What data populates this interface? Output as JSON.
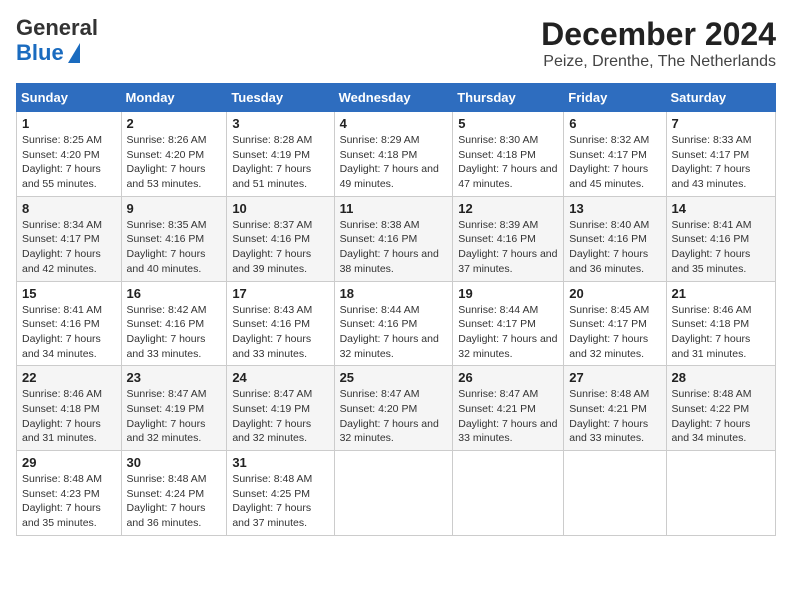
{
  "logo": {
    "line1": "General",
    "line2": "Blue"
  },
  "title": "December 2024",
  "subtitle": "Peize, Drenthe, The Netherlands",
  "days_of_week": [
    "Sunday",
    "Monday",
    "Tuesday",
    "Wednesday",
    "Thursday",
    "Friday",
    "Saturday"
  ],
  "weeks": [
    [
      {
        "day": "1",
        "sunrise": "8:25 AM",
        "sunset": "4:20 PM",
        "daylight": "7 hours and 55 minutes."
      },
      {
        "day": "2",
        "sunrise": "8:26 AM",
        "sunset": "4:20 PM",
        "daylight": "7 hours and 53 minutes."
      },
      {
        "day": "3",
        "sunrise": "8:28 AM",
        "sunset": "4:19 PM",
        "daylight": "7 hours and 51 minutes."
      },
      {
        "day": "4",
        "sunrise": "8:29 AM",
        "sunset": "4:18 PM",
        "daylight": "7 hours and 49 minutes."
      },
      {
        "day": "5",
        "sunrise": "8:30 AM",
        "sunset": "4:18 PM",
        "daylight": "7 hours and 47 minutes."
      },
      {
        "day": "6",
        "sunrise": "8:32 AM",
        "sunset": "4:17 PM",
        "daylight": "7 hours and 45 minutes."
      },
      {
        "day": "7",
        "sunrise": "8:33 AM",
        "sunset": "4:17 PM",
        "daylight": "7 hours and 43 minutes."
      }
    ],
    [
      {
        "day": "8",
        "sunrise": "8:34 AM",
        "sunset": "4:17 PM",
        "daylight": "7 hours and 42 minutes."
      },
      {
        "day": "9",
        "sunrise": "8:35 AM",
        "sunset": "4:16 PM",
        "daylight": "7 hours and 40 minutes."
      },
      {
        "day": "10",
        "sunrise": "8:37 AM",
        "sunset": "4:16 PM",
        "daylight": "7 hours and 39 minutes."
      },
      {
        "day": "11",
        "sunrise": "8:38 AM",
        "sunset": "4:16 PM",
        "daylight": "7 hours and 38 minutes."
      },
      {
        "day": "12",
        "sunrise": "8:39 AM",
        "sunset": "4:16 PM",
        "daylight": "7 hours and 37 minutes."
      },
      {
        "day": "13",
        "sunrise": "8:40 AM",
        "sunset": "4:16 PM",
        "daylight": "7 hours and 36 minutes."
      },
      {
        "day": "14",
        "sunrise": "8:41 AM",
        "sunset": "4:16 PM",
        "daylight": "7 hours and 35 minutes."
      }
    ],
    [
      {
        "day": "15",
        "sunrise": "8:41 AM",
        "sunset": "4:16 PM",
        "daylight": "7 hours and 34 minutes."
      },
      {
        "day": "16",
        "sunrise": "8:42 AM",
        "sunset": "4:16 PM",
        "daylight": "7 hours and 33 minutes."
      },
      {
        "day": "17",
        "sunrise": "8:43 AM",
        "sunset": "4:16 PM",
        "daylight": "7 hours and 33 minutes."
      },
      {
        "day": "18",
        "sunrise": "8:44 AM",
        "sunset": "4:16 PM",
        "daylight": "7 hours and 32 minutes."
      },
      {
        "day": "19",
        "sunrise": "8:44 AM",
        "sunset": "4:17 PM",
        "daylight": "7 hours and 32 minutes."
      },
      {
        "day": "20",
        "sunrise": "8:45 AM",
        "sunset": "4:17 PM",
        "daylight": "7 hours and 32 minutes."
      },
      {
        "day": "21",
        "sunrise": "8:46 AM",
        "sunset": "4:18 PM",
        "daylight": "7 hours and 31 minutes."
      }
    ],
    [
      {
        "day": "22",
        "sunrise": "8:46 AM",
        "sunset": "4:18 PM",
        "daylight": "7 hours and 31 minutes."
      },
      {
        "day": "23",
        "sunrise": "8:47 AM",
        "sunset": "4:19 PM",
        "daylight": "7 hours and 32 minutes."
      },
      {
        "day": "24",
        "sunrise": "8:47 AM",
        "sunset": "4:19 PM",
        "daylight": "7 hours and 32 minutes."
      },
      {
        "day": "25",
        "sunrise": "8:47 AM",
        "sunset": "4:20 PM",
        "daylight": "7 hours and 32 minutes."
      },
      {
        "day": "26",
        "sunrise": "8:47 AM",
        "sunset": "4:21 PM",
        "daylight": "7 hours and 33 minutes."
      },
      {
        "day": "27",
        "sunrise": "8:48 AM",
        "sunset": "4:21 PM",
        "daylight": "7 hours and 33 minutes."
      },
      {
        "day": "28",
        "sunrise": "8:48 AM",
        "sunset": "4:22 PM",
        "daylight": "7 hours and 34 minutes."
      }
    ],
    [
      {
        "day": "29",
        "sunrise": "8:48 AM",
        "sunset": "4:23 PM",
        "daylight": "7 hours and 35 minutes."
      },
      {
        "day": "30",
        "sunrise": "8:48 AM",
        "sunset": "4:24 PM",
        "daylight": "7 hours and 36 minutes."
      },
      {
        "day": "31",
        "sunrise": "8:48 AM",
        "sunset": "4:25 PM",
        "daylight": "7 hours and 37 minutes."
      },
      null,
      null,
      null,
      null
    ]
  ]
}
